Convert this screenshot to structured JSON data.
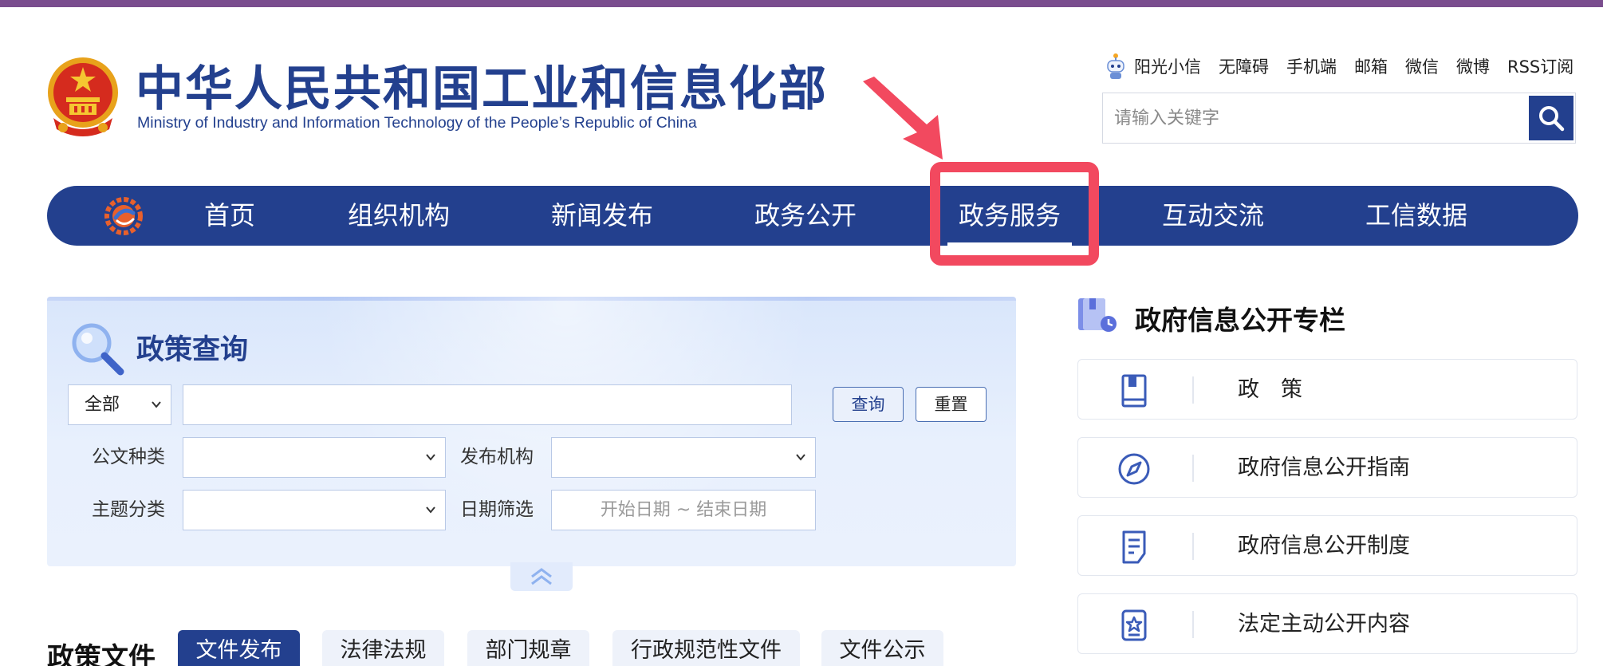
{
  "header": {
    "title_cn": "中华人民共和国工业和信息化部",
    "title_en": "Ministry of Industry and Information Technology of the People’s Republic of China",
    "quick_links": [
      "阳光小信",
      "无障碍",
      "手机端",
      "邮箱",
      "微信",
      "微博",
      "RSS订阅"
    ],
    "search": {
      "placeholder": "请输入关键字",
      "value": ""
    }
  },
  "nav": {
    "items": [
      "首页",
      "组织机构",
      "新闻发布",
      "政务公开",
      "政务服务",
      "互动交流",
      "工信数据"
    ],
    "active": "政务服务"
  },
  "policy_query": {
    "title": "政策查询",
    "scope_select": "全部",
    "keyword": "",
    "query_button": "查询",
    "reset_button": "重置",
    "doc_type_label": "公文种类",
    "doc_type_value": "",
    "publisher_label": "发布机构",
    "publisher_value": "",
    "topic_label": "主题分类",
    "topic_value": "",
    "date_label": "日期筛选",
    "date_placeholder": "开始日期 ~ 结束日期"
  },
  "policy_docs": {
    "title": "政策文件",
    "tabs": [
      "文件发布",
      "法律法规",
      "部门规章",
      "行政规范性文件",
      "文件公示"
    ],
    "active_tab": "文件发布"
  },
  "gov_info": {
    "title": "政府信息公开专栏",
    "items": [
      "政　策",
      "政府信息公开指南",
      "政府信息公开制度",
      "法定主动公开内容"
    ]
  },
  "colors": {
    "primary": "#23408e",
    "top_bar": "#7a4d8e",
    "highlight": "#f2495f",
    "panel_bg": "#e8f0fd"
  },
  "icons": [
    "national-emblem-icon",
    "robot-icon",
    "search-icon",
    "site-logo-icon",
    "arrow-icon",
    "magnifier-icon",
    "chevron-down-icon",
    "double-chevron-up-icon",
    "book-icon",
    "compass-icon",
    "document-icon",
    "badge-icon"
  ]
}
